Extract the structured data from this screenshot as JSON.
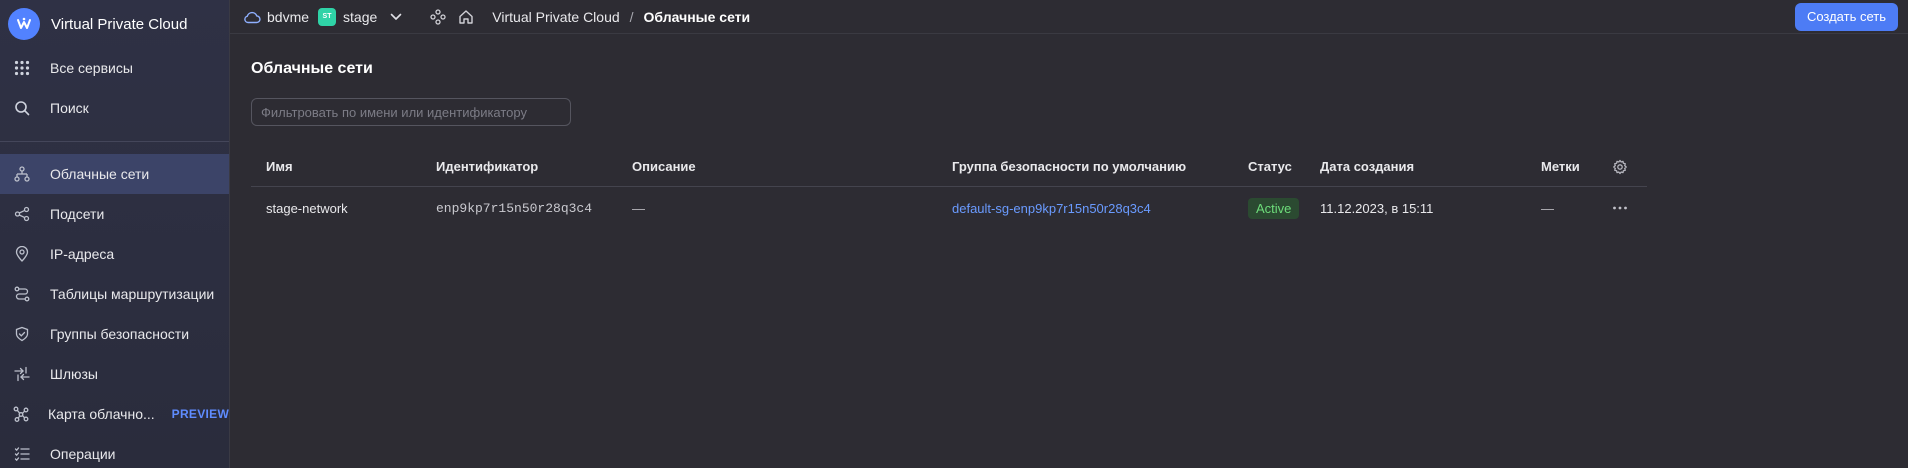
{
  "sidebar": {
    "title": "Virtual Private Cloud",
    "top_items": [
      {
        "label": "Все сервисы",
        "icon": "grid-icon"
      },
      {
        "label": "Поиск",
        "icon": "search-icon"
      }
    ],
    "items": [
      {
        "label": "Облачные сети",
        "icon": "network-icon",
        "active": true
      },
      {
        "label": "Подсети",
        "icon": "subnets-icon"
      },
      {
        "label": "IP-адреса",
        "icon": "location-pin-icon"
      },
      {
        "label": "Таблицы маршрутизации",
        "icon": "routes-icon"
      },
      {
        "label": "Группы безопасности",
        "icon": "shield-icon"
      },
      {
        "label": "Шлюзы",
        "icon": "gateway-arrows-icon"
      },
      {
        "label": "Карта облачно...",
        "icon": "map-graph-icon",
        "badge": "PREVIEW"
      },
      {
        "label": "Операции",
        "icon": "list-check-icon"
      }
    ]
  },
  "topbar": {
    "cloud": "bdvme",
    "folder_badge": "ST",
    "folder": "stage",
    "breadcrumb_root": "Virtual Private Cloud",
    "breadcrumb_sep": "/",
    "breadcrumb_current": "Облачные сети",
    "create_button": "Создать сеть"
  },
  "page": {
    "title": "Облачные сети",
    "filter_placeholder": "Фильтровать по имени или идентификатору"
  },
  "table": {
    "columns": [
      "Имя",
      "Идентификатор",
      "Описание",
      "Группа безопасности по умолчанию",
      "Статус",
      "Дата создания",
      "Метки"
    ],
    "rows": [
      {
        "name": "stage-network",
        "id": "enp9kp7r15n50r28q3c4",
        "description": "—",
        "security_group": "default-sg-enp9kp7r15n50r28q3c4",
        "status": "Active",
        "created": "11.12.2023, в 15:11",
        "labels": "—"
      }
    ]
  },
  "colors": {
    "accent": "#4d7cf5",
    "link": "#6a9bff",
    "status_active_bg": "#2b4a31",
    "status_active_text": "#6ddc7a",
    "preview": "#5f8cff",
    "folder_badge": "#2fd3a7"
  }
}
